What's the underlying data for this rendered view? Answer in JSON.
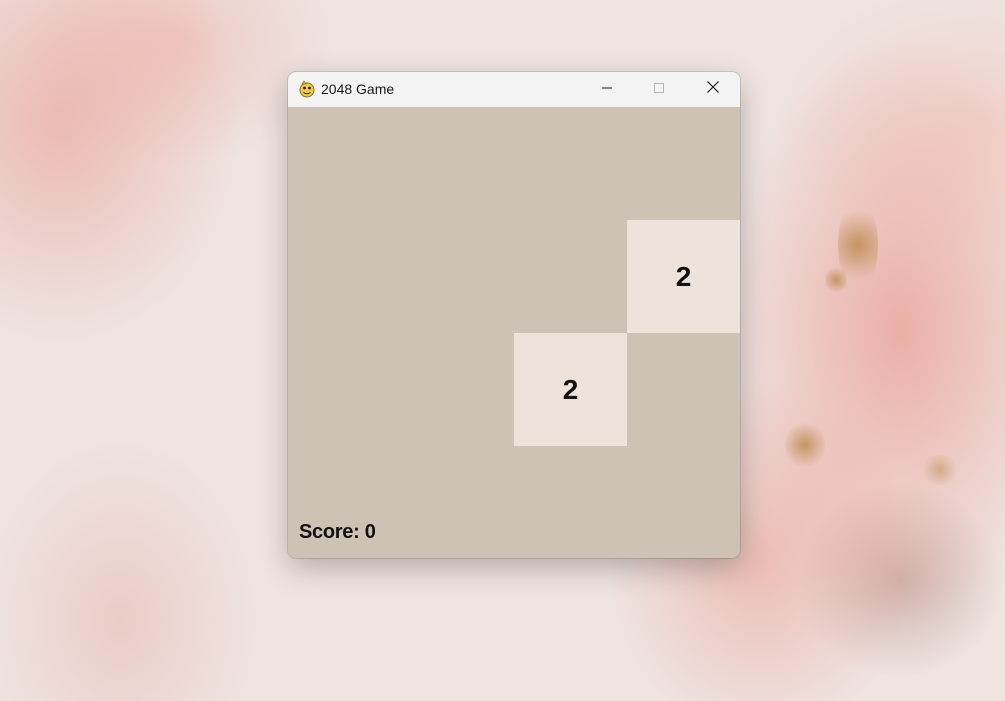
{
  "window": {
    "title": "2048 Game",
    "app_icon": "python-snake-icon"
  },
  "titlebar_buttons": {
    "minimize_icon": "minimize-icon",
    "maximize_icon": "maximize-icon",
    "close_icon": "close-icon"
  },
  "game": {
    "grid_size": 4,
    "tiles": [
      {
        "row": 1,
        "col": 3,
        "value": "2"
      },
      {
        "row": 2,
        "col": 2,
        "value": "2"
      }
    ],
    "score_label": "Score: 0",
    "score": 0
  },
  "colors": {
    "board_bg": "#cec2b4",
    "tile_2_bg": "#eee3da",
    "tile_text": "#111111",
    "titlebar_bg": "#f3f3f3"
  }
}
